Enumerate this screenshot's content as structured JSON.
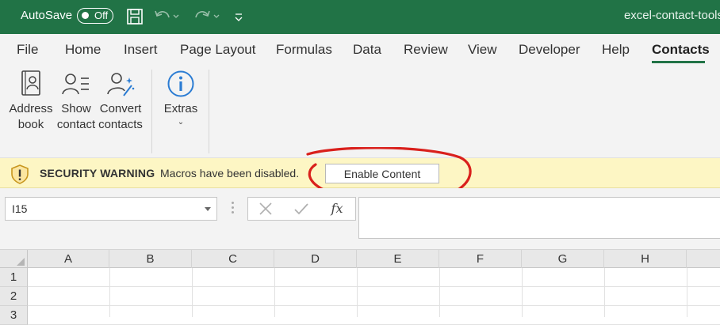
{
  "titlebar": {
    "autosave_label": "AutoSave",
    "autosave_state": "Off",
    "document_title": "excel-contact-tools"
  },
  "menu": {
    "items": [
      "File",
      "Home",
      "Insert",
      "Page Layout",
      "Formulas",
      "Data",
      "Review",
      "View",
      "Developer",
      "Help",
      "Contacts"
    ],
    "active": "Contacts"
  },
  "ribbon": {
    "address_book": [
      "Address",
      "book"
    ],
    "show_contact": [
      "Show",
      "contact"
    ],
    "convert_contacts": [
      "Convert",
      "contacts"
    ],
    "extras": "Extras",
    "icon_color": "#2b7cd3"
  },
  "security_bar": {
    "title": "SECURITY WARNING",
    "message": "Macros have been disabled.",
    "button_label": "Enable Content",
    "annotation_color": "#d9201c"
  },
  "formula_bar": {
    "name_box_value": "I15",
    "fx_label": "fx",
    "formula_value": ""
  },
  "grid": {
    "columns": [
      "A",
      "B",
      "C",
      "D",
      "E",
      "F",
      "G",
      "H"
    ],
    "rows": [
      "1",
      "2",
      "3"
    ]
  },
  "colors": {
    "brand_green": "#217346",
    "warning_bg": "#fdf6c4"
  }
}
